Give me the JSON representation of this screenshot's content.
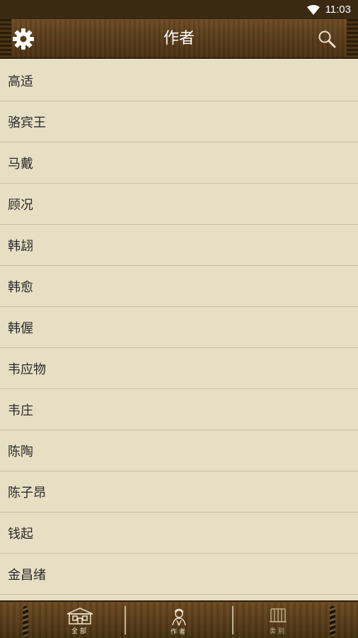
{
  "status": {
    "time": "11:03"
  },
  "header": {
    "title": "作者"
  },
  "authors": [
    "高适",
    "骆宾王",
    "马戴",
    "顾况",
    "韩翃",
    "韩愈",
    "韩偓",
    "韦应物",
    "韦庄",
    "陈陶",
    "陈子昂",
    "钱起",
    "金昌绪"
  ],
  "tabs": [
    {
      "label": "全部",
      "icon": "building-icon"
    },
    {
      "label": "作者",
      "icon": "scholar-icon"
    },
    {
      "label": "类别",
      "icon": "scroll-icon"
    }
  ],
  "colors": {
    "background": "#e6dfc4",
    "header": "#5a3c1a",
    "statusbar": "#3a2a14"
  }
}
